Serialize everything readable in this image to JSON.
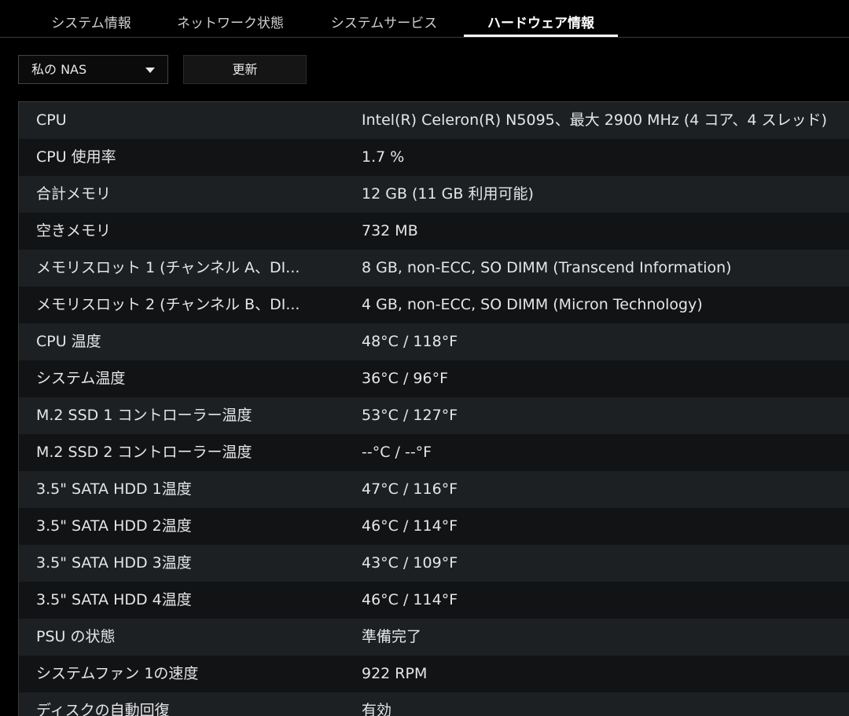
{
  "tabs": [
    {
      "label": "システム情報",
      "active": false
    },
    {
      "label": "ネットワーク状態",
      "active": false
    },
    {
      "label": "システムサービス",
      "active": false
    },
    {
      "label": "ハードウェア情報",
      "active": true
    }
  ],
  "toolbar": {
    "device_select_value": "私の NAS",
    "refresh_label": "更新"
  },
  "hardware_rows": [
    {
      "key": "CPU",
      "value": "Intel(R) Celeron(R) N5095、最大 2900 MHz (4 コア、4 スレッド)"
    },
    {
      "key": "CPU 使用率",
      "value": "1.7 %"
    },
    {
      "key": "合計メモリ",
      "value": "12 GB (11 GB 利用可能)"
    },
    {
      "key": "空きメモリ",
      "value": "732 MB"
    },
    {
      "key": "メモリスロット 1 (チャンネル A、DI...",
      "value": "8 GB, non-ECC, SO DIMM (Transcend Information)"
    },
    {
      "key": "メモリスロット 2 (チャンネル B、DI...",
      "value": "4 GB, non-ECC, SO DIMM (Micron Technology)"
    },
    {
      "key": "CPU 温度",
      "value": "48°C / 118°F"
    },
    {
      "key": "システム温度",
      "value": "36°C / 96°F"
    },
    {
      "key": "M.2 SSD 1 コントローラー温度",
      "value": "53°C / 127°F"
    },
    {
      "key": "M.2 SSD 2 コントローラー温度",
      "value": "--°C / --°F"
    },
    {
      "key": "3.5\" SATA HDD 1温度",
      "value": "47°C / 116°F"
    },
    {
      "key": "3.5\" SATA HDD 2温度",
      "value": "46°C / 114°F"
    },
    {
      "key": "3.5\" SATA HDD 3温度",
      "value": "43°C / 109°F"
    },
    {
      "key": "3.5\" SATA HDD 4温度",
      "value": "46°C / 114°F"
    },
    {
      "key": "PSU の状態",
      "value": "準備完了"
    },
    {
      "key": "システムファン 1の速度",
      "value": "922 RPM"
    },
    {
      "key": "ディスクの自動回復",
      "value": "有効"
    }
  ]
}
